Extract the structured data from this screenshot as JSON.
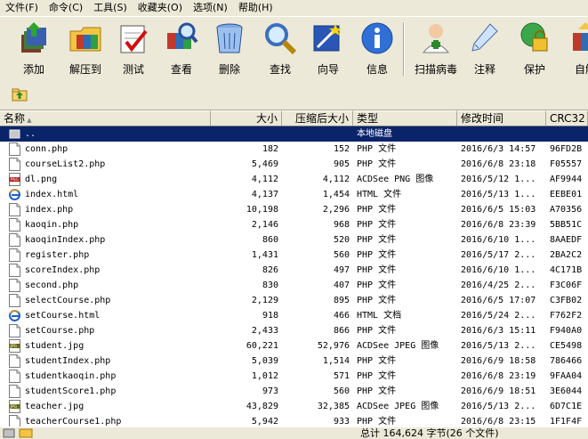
{
  "menu": [
    "文件(F)",
    "命令(C)",
    "工具(S)",
    "收藏夹(O)",
    "选项(N)",
    "帮助(H)"
  ],
  "toolbar": [
    {
      "label": "添加",
      "icon": "add-icon"
    },
    {
      "label": "解压到",
      "icon": "extract-to-icon"
    },
    {
      "label": "测试",
      "icon": "test-icon"
    },
    {
      "label": "查看",
      "icon": "view-icon"
    },
    {
      "label": "删除",
      "icon": "delete-icon"
    },
    {
      "label": "查找",
      "icon": "find-icon"
    },
    {
      "label": "向导",
      "icon": "wizard-icon"
    },
    {
      "label": "信息",
      "icon": "info-icon"
    },
    {
      "label": "扫描病毒",
      "icon": "virus-scan-icon"
    },
    {
      "label": "注释",
      "icon": "comment-icon"
    },
    {
      "label": "保护",
      "icon": "protect-icon"
    },
    {
      "label": "自解",
      "icon": "sfx-icon"
    }
  ],
  "columns": [
    "名称",
    "大小",
    "压缩后大小",
    "类型",
    "修改时间",
    "CRC32"
  ],
  "parent_row": {
    "name": "..",
    "type": "本地磁盘"
  },
  "files": [
    {
      "name": "conn.php",
      "size": "182",
      "packed": "152",
      "type": "PHP 文件",
      "modified": "2016/6/3 14:57",
      "crc": "96FD2B",
      "icon": "php"
    },
    {
      "name": "courseList2.php",
      "size": "5,469",
      "packed": "905",
      "type": "PHP 文件",
      "modified": "2016/6/8 23:18",
      "crc": "F05557",
      "icon": "php"
    },
    {
      "name": "dl.png",
      "size": "4,112",
      "packed": "4,112",
      "type": "ACDSee PNG 图像",
      "modified": "2016/5/12 1...",
      "crc": "AF9944",
      "icon": "png"
    },
    {
      "name": "index.html",
      "size": "4,137",
      "packed": "1,454",
      "type": "HTML 文件",
      "modified": "2016/5/13 1...",
      "crc": "EEBE01",
      "icon": "html"
    },
    {
      "name": "index.php",
      "size": "10,198",
      "packed": "2,296",
      "type": "PHP 文件",
      "modified": "2016/6/5 15:03",
      "crc": "A70356",
      "icon": "php"
    },
    {
      "name": "kaoqin.php",
      "size": "2,146",
      "packed": "968",
      "type": "PHP 文件",
      "modified": "2016/6/8 23:39",
      "crc": "5BB51C",
      "icon": "php"
    },
    {
      "name": "kaoqinIndex.php",
      "size": "860",
      "packed": "520",
      "type": "PHP 文件",
      "modified": "2016/6/10 1...",
      "crc": "8AAEDF",
      "icon": "php"
    },
    {
      "name": "register.php",
      "size": "1,431",
      "packed": "560",
      "type": "PHP 文件",
      "modified": "2016/5/17 2...",
      "crc": "2BA2C2",
      "icon": "php"
    },
    {
      "name": "scoreIndex.php",
      "size": "826",
      "packed": "497",
      "type": "PHP 文件",
      "modified": "2016/6/10 1...",
      "crc": "4C171B",
      "icon": "php"
    },
    {
      "name": "second.php",
      "size": "830",
      "packed": "407",
      "type": "PHP 文件",
      "modified": "2016/4/25 2...",
      "crc": "F3C06F",
      "icon": "php"
    },
    {
      "name": "selectCourse.php",
      "size": "2,129",
      "packed": "895",
      "type": "PHP 文件",
      "modified": "2016/6/5 17:07",
      "crc": "C3FB02",
      "icon": "php"
    },
    {
      "name": "setCourse.html",
      "size": "918",
      "packed": "466",
      "type": "HTML 文档",
      "modified": "2016/5/24 2...",
      "crc": "F762F2",
      "icon": "html"
    },
    {
      "name": "setCourse.php",
      "size": "2,433",
      "packed": "866",
      "type": "PHP 文件",
      "modified": "2016/6/3 15:11",
      "crc": "F940A0",
      "icon": "php"
    },
    {
      "name": "student.jpg",
      "size": "60,221",
      "packed": "52,976",
      "type": "ACDSee JPEG 图像",
      "modified": "2016/5/13 2...",
      "crc": "CE5498",
      "icon": "jpg"
    },
    {
      "name": "studentIndex.php",
      "size": "5,039",
      "packed": "1,514",
      "type": "PHP 文件",
      "modified": "2016/6/9 18:58",
      "crc": "786466",
      "icon": "php"
    },
    {
      "name": "studentkaoqin.php",
      "size": "1,012",
      "packed": "571",
      "type": "PHP 文件",
      "modified": "2016/6/8 23:19",
      "crc": "9FAA04",
      "icon": "php"
    },
    {
      "name": "studentScore1.php",
      "size": "973",
      "packed": "560",
      "type": "PHP 文件",
      "modified": "2016/6/9 18:51",
      "crc": "3E6044",
      "icon": "php"
    },
    {
      "name": "teacher.jpg",
      "size": "43,829",
      "packed": "32,385",
      "type": "ACDSee JPEG 图像",
      "modified": "2016/5/13 2...",
      "crc": "6D7C1E",
      "icon": "jpg"
    },
    {
      "name": "teacherCourse1.php",
      "size": "5,942",
      "packed": "933",
      "type": "PHP 文件",
      "modified": "2016/6/8 23:15",
      "crc": "1F1F4F",
      "icon": "php"
    }
  ],
  "status": "总计 164,624 字节(26 个文件)"
}
